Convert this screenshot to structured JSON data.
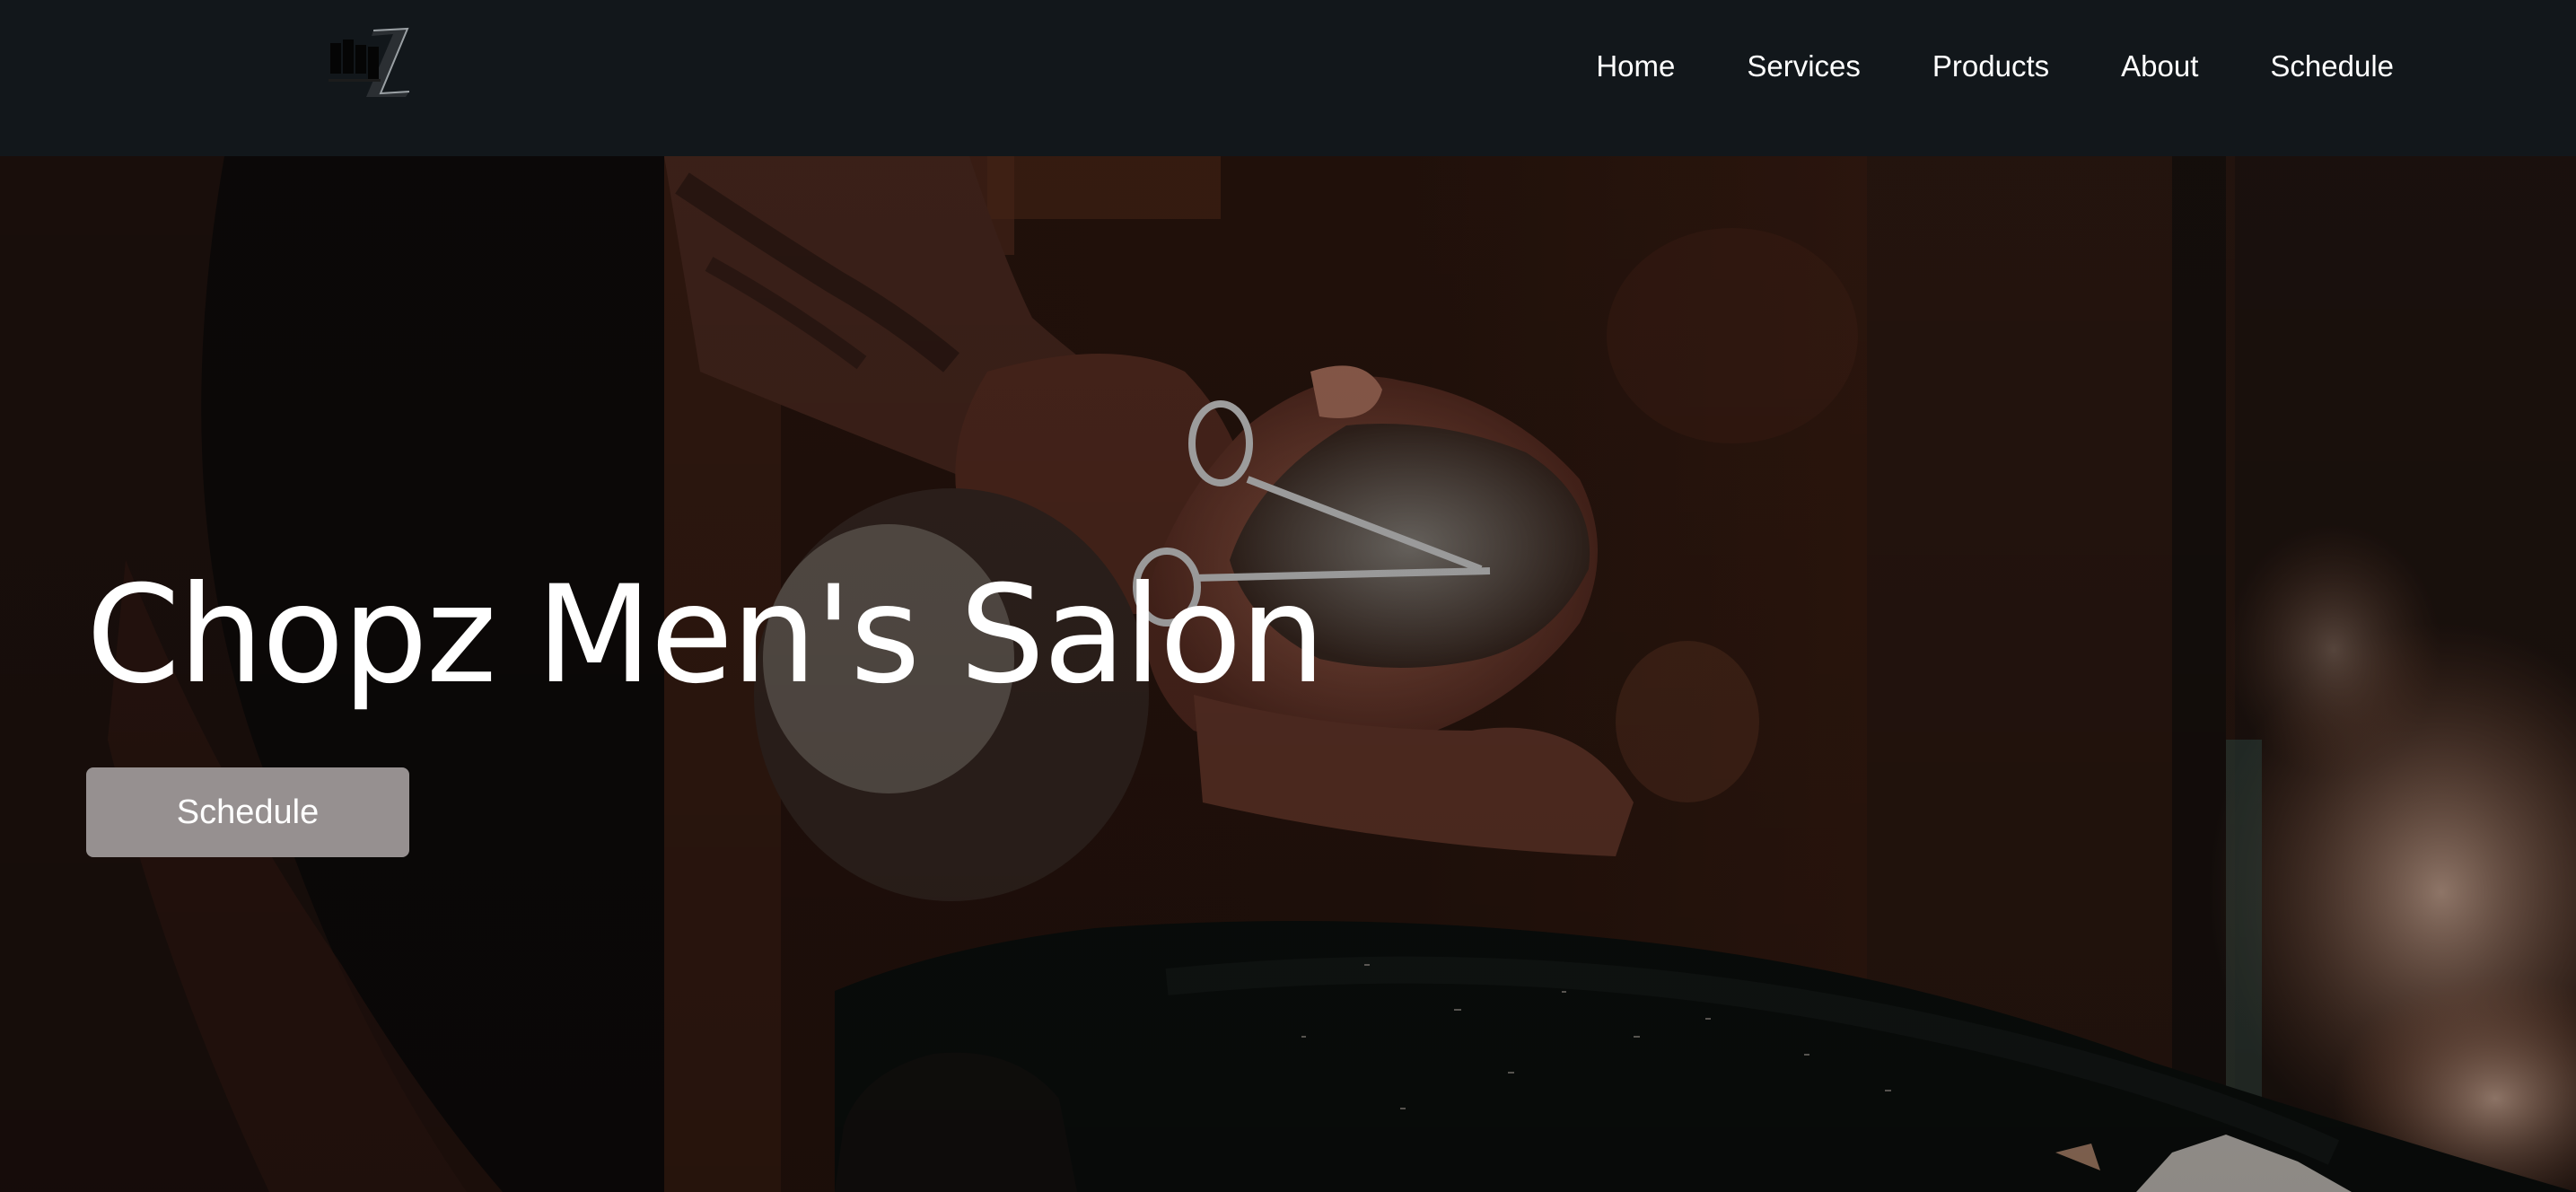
{
  "brand": {
    "logo_text": "chopZ",
    "logo_icon": "chopz-scissor-logo"
  },
  "nav": {
    "items": [
      {
        "label": "Home"
      },
      {
        "label": "Services"
      },
      {
        "label": "Products"
      },
      {
        "label": "About"
      },
      {
        "label": "Schedule"
      }
    ]
  },
  "hero": {
    "title": "Chopz Men's Salon",
    "cta_label": "Schedule",
    "image": "barber-trimming-beard-photo"
  },
  "colors": {
    "nav_bg": "#12171b",
    "nav_text": "#ffffff",
    "hero_title": "#ffffff",
    "button_bg": "#969090",
    "button_text": "#ffffff"
  }
}
